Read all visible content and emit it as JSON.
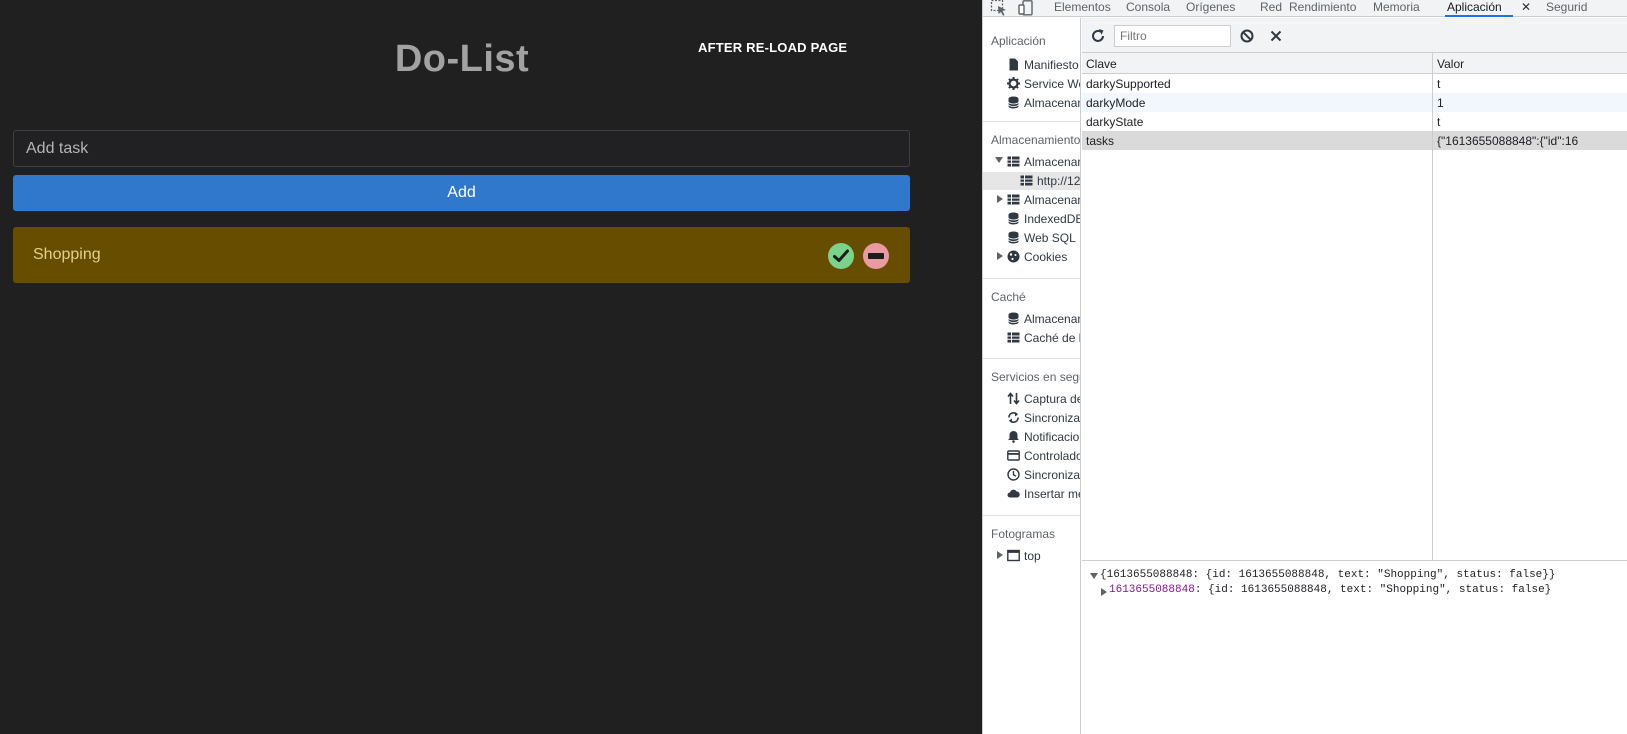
{
  "app": {
    "title": "Do-List",
    "note": "AFTER RE-LOAD PAGE",
    "input_placeholder": "Add task",
    "add_button": "Add",
    "tasks": [
      {
        "text": "Shopping",
        "status": false
      }
    ]
  },
  "devtools": {
    "tabs": [
      "Elementos",
      "Consola",
      "Orígenes",
      "Red",
      "Rendimiento",
      "Memoria",
      "Aplicación",
      "Segurid"
    ],
    "active_tab": "Aplicación",
    "sidebar": {
      "aplicacion_header": "Aplicación",
      "aplicacion_items": [
        "Manifiesto",
        "Service Wo",
        "Almacenam"
      ],
      "almacenamiento_header": "Almacenamiento",
      "almacenamiento_items": [
        "Almacenam",
        "http://12",
        "Almacenam",
        "IndexedDB",
        "Web SQL",
        "Cookies"
      ],
      "cache_header": "Caché",
      "cache_items": [
        "Almacenam",
        "Caché de la"
      ],
      "servicios_header": "Servicios en segu",
      "servicios_items": [
        "Captura de",
        "Sincronizac",
        "Notificacio",
        "Controlado",
        "Sincronizac",
        "Insertar me"
      ],
      "fotogramas_header": "Fotogramas",
      "fotogramas_items": [
        "top"
      ]
    },
    "filter_placeholder": "Filtro",
    "table": {
      "key_header": "Clave",
      "value_header": "Valor",
      "rows": [
        {
          "key": "darkySupported",
          "value": "t"
        },
        {
          "key": "darkyMode",
          "value": "1"
        },
        {
          "key": "darkyState",
          "value": "t"
        },
        {
          "key": "tasks",
          "value": "{\"1613655088848\":{\"id\":16"
        }
      ]
    },
    "preview": {
      "line1": "{1613655088848: {id: 1613655088848, text: \"Shopping\", status: false}}",
      "line2_key": "1613655088848",
      "line2_rest": ": {id: 1613655088848, text: \"Shopping\", status: false}"
    }
  },
  "colors": {
    "app_bg": "#202021",
    "add_button": "#2f78cb",
    "task_row": "#664d00",
    "done_button": "#7bd28a",
    "remove_button": "#e99aa3",
    "devtools_accent": "#1a73e8"
  }
}
